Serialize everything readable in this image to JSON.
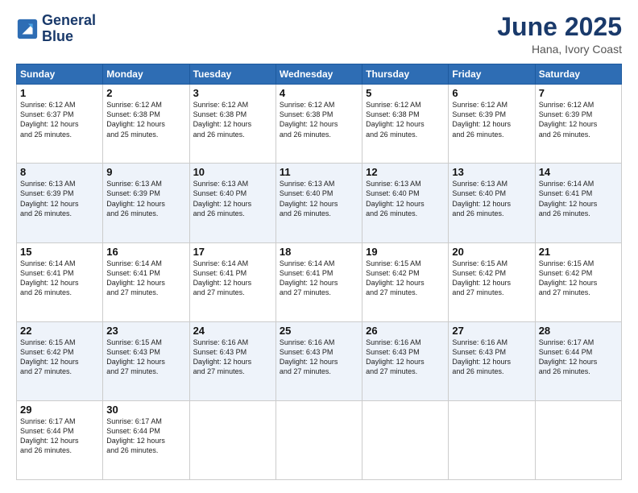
{
  "logo": {
    "line1": "General",
    "line2": "Blue"
  },
  "title": "June 2025",
  "location": "Hana, Ivory Coast",
  "days_of_week": [
    "Sunday",
    "Monday",
    "Tuesday",
    "Wednesday",
    "Thursday",
    "Friday",
    "Saturday"
  ],
  "weeks": [
    [
      {
        "day": 1,
        "info": "Sunrise: 6:12 AM\nSunset: 6:37 PM\nDaylight: 12 hours\nand 25 minutes."
      },
      {
        "day": 2,
        "info": "Sunrise: 6:12 AM\nSunset: 6:38 PM\nDaylight: 12 hours\nand 25 minutes."
      },
      {
        "day": 3,
        "info": "Sunrise: 6:12 AM\nSunset: 6:38 PM\nDaylight: 12 hours\nand 26 minutes."
      },
      {
        "day": 4,
        "info": "Sunrise: 6:12 AM\nSunset: 6:38 PM\nDaylight: 12 hours\nand 26 minutes."
      },
      {
        "day": 5,
        "info": "Sunrise: 6:12 AM\nSunset: 6:38 PM\nDaylight: 12 hours\nand 26 minutes."
      },
      {
        "day": 6,
        "info": "Sunrise: 6:12 AM\nSunset: 6:39 PM\nDaylight: 12 hours\nand 26 minutes."
      },
      {
        "day": 7,
        "info": "Sunrise: 6:12 AM\nSunset: 6:39 PM\nDaylight: 12 hours\nand 26 minutes."
      }
    ],
    [
      {
        "day": 8,
        "info": "Sunrise: 6:13 AM\nSunset: 6:39 PM\nDaylight: 12 hours\nand 26 minutes."
      },
      {
        "day": 9,
        "info": "Sunrise: 6:13 AM\nSunset: 6:39 PM\nDaylight: 12 hours\nand 26 minutes."
      },
      {
        "day": 10,
        "info": "Sunrise: 6:13 AM\nSunset: 6:40 PM\nDaylight: 12 hours\nand 26 minutes."
      },
      {
        "day": 11,
        "info": "Sunrise: 6:13 AM\nSunset: 6:40 PM\nDaylight: 12 hours\nand 26 minutes."
      },
      {
        "day": 12,
        "info": "Sunrise: 6:13 AM\nSunset: 6:40 PM\nDaylight: 12 hours\nand 26 minutes."
      },
      {
        "day": 13,
        "info": "Sunrise: 6:13 AM\nSunset: 6:40 PM\nDaylight: 12 hours\nand 26 minutes."
      },
      {
        "day": 14,
        "info": "Sunrise: 6:14 AM\nSunset: 6:41 PM\nDaylight: 12 hours\nand 26 minutes."
      }
    ],
    [
      {
        "day": 15,
        "info": "Sunrise: 6:14 AM\nSunset: 6:41 PM\nDaylight: 12 hours\nand 26 minutes."
      },
      {
        "day": 16,
        "info": "Sunrise: 6:14 AM\nSunset: 6:41 PM\nDaylight: 12 hours\nand 27 minutes."
      },
      {
        "day": 17,
        "info": "Sunrise: 6:14 AM\nSunset: 6:41 PM\nDaylight: 12 hours\nand 27 minutes."
      },
      {
        "day": 18,
        "info": "Sunrise: 6:14 AM\nSunset: 6:41 PM\nDaylight: 12 hours\nand 27 minutes."
      },
      {
        "day": 19,
        "info": "Sunrise: 6:15 AM\nSunset: 6:42 PM\nDaylight: 12 hours\nand 27 minutes."
      },
      {
        "day": 20,
        "info": "Sunrise: 6:15 AM\nSunset: 6:42 PM\nDaylight: 12 hours\nand 27 minutes."
      },
      {
        "day": 21,
        "info": "Sunrise: 6:15 AM\nSunset: 6:42 PM\nDaylight: 12 hours\nand 27 minutes."
      }
    ],
    [
      {
        "day": 22,
        "info": "Sunrise: 6:15 AM\nSunset: 6:42 PM\nDaylight: 12 hours\nand 27 minutes."
      },
      {
        "day": 23,
        "info": "Sunrise: 6:15 AM\nSunset: 6:43 PM\nDaylight: 12 hours\nand 27 minutes."
      },
      {
        "day": 24,
        "info": "Sunrise: 6:16 AM\nSunset: 6:43 PM\nDaylight: 12 hours\nand 27 minutes."
      },
      {
        "day": 25,
        "info": "Sunrise: 6:16 AM\nSunset: 6:43 PM\nDaylight: 12 hours\nand 27 minutes."
      },
      {
        "day": 26,
        "info": "Sunrise: 6:16 AM\nSunset: 6:43 PM\nDaylight: 12 hours\nand 27 minutes."
      },
      {
        "day": 27,
        "info": "Sunrise: 6:16 AM\nSunset: 6:43 PM\nDaylight: 12 hours\nand 26 minutes."
      },
      {
        "day": 28,
        "info": "Sunrise: 6:17 AM\nSunset: 6:44 PM\nDaylight: 12 hours\nand 26 minutes."
      }
    ],
    [
      {
        "day": 29,
        "info": "Sunrise: 6:17 AM\nSunset: 6:44 PM\nDaylight: 12 hours\nand 26 minutes."
      },
      {
        "day": 30,
        "info": "Sunrise: 6:17 AM\nSunset: 6:44 PM\nDaylight: 12 hours\nand 26 minutes."
      },
      {
        "day": null
      },
      {
        "day": null
      },
      {
        "day": null
      },
      {
        "day": null
      },
      {
        "day": null
      }
    ]
  ]
}
